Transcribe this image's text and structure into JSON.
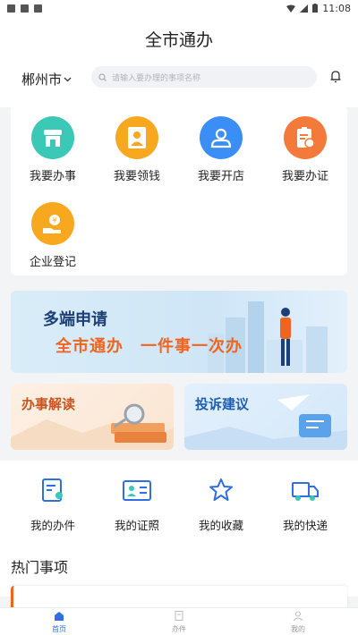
{
  "status_bar": {
    "time": "11:08"
  },
  "header": {
    "title": "全市通办",
    "city": "郴州市",
    "search_placeholder": "请输入要办理的事项名称"
  },
  "services": [
    {
      "label": "我要办事",
      "color": "#3cc8b7",
      "icon": "storefront-icon"
    },
    {
      "label": "我要领钱",
      "color": "#f7a81f",
      "icon": "person-card-icon"
    },
    {
      "label": "我要开店",
      "color": "#3a8ef6",
      "icon": "user-icon"
    },
    {
      "label": "我要办证",
      "color": "#f47a3c",
      "icon": "clipboard-icon"
    },
    {
      "label": "企业登记",
      "color": "#f7a81f",
      "icon": "coin-hand-icon"
    }
  ],
  "banner": {
    "line1": "多端申请",
    "line2": "全市通办　一件事一次办"
  },
  "cards": [
    {
      "label": "办事解读",
      "color": "#c9541e"
    },
    {
      "label": "投诉建议",
      "color": "#1f5fb0"
    }
  ],
  "my_items": [
    {
      "label": "我的办件",
      "icon": "document-person-icon"
    },
    {
      "label": "我的证照",
      "icon": "id-card-icon"
    },
    {
      "label": "我的收藏",
      "icon": "star-icon"
    },
    {
      "label": "我的快递",
      "icon": "truck-icon"
    }
  ],
  "hot": {
    "title": "热门事项"
  },
  "tabs": [
    {
      "label": "首页",
      "active": true
    },
    {
      "label": "办件",
      "active": false
    },
    {
      "label": "我的",
      "active": false
    }
  ],
  "colors": {
    "accent": "#2f6fe0",
    "orange": "#f0641e",
    "navy": "#1d3f78"
  }
}
